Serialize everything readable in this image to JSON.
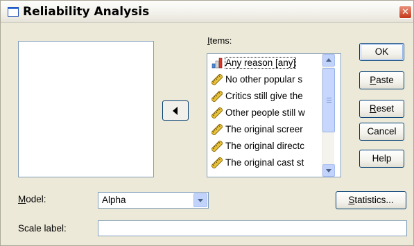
{
  "window": {
    "title": "Reliability Analysis",
    "close_glyph": "✕"
  },
  "source_list": {
    "items": []
  },
  "move_button": {
    "icon": "left-arrow-icon"
  },
  "items": {
    "label_accesskey": "I",
    "label_rest": "tems:",
    "list": [
      {
        "label": "Any reason [any]",
        "icon": "nominal-bar-chart-icon",
        "selected": true
      },
      {
        "label": "No other popular s",
        "icon": "scale-ruler-icon"
      },
      {
        "label": "Critics still give the",
        "icon": "scale-ruler-icon"
      },
      {
        "label": "Other people still w",
        "icon": "scale-ruler-icon"
      },
      {
        "label": "The original screer",
        "icon": "scale-ruler-icon"
      },
      {
        "label": "The original directc",
        "icon": "scale-ruler-icon"
      },
      {
        "label": "The original cast st",
        "icon": "scale-ruler-icon"
      }
    ]
  },
  "buttons": {
    "ok": "OK",
    "paste_key": "P",
    "paste_rest": "aste",
    "reset_key": "R",
    "reset_rest": "eset",
    "cancel": "Cancel",
    "help": "Help",
    "statistics_key": "S",
    "statistics_rest": "tatistics..."
  },
  "model": {
    "label_key": "M",
    "label_rest": "odel:",
    "value": "Alpha"
  },
  "scale_label": {
    "label": "Scale label:",
    "value": ""
  }
}
